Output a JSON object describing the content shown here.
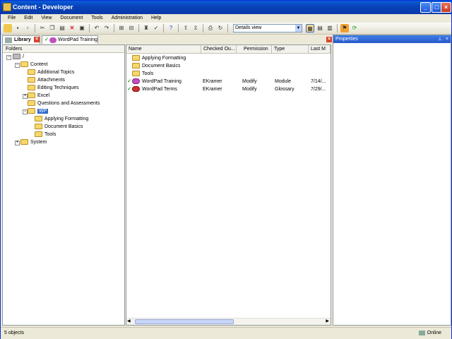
{
  "window": {
    "title": "Content - Developer",
    "min": "_",
    "max": "□",
    "close": "×"
  },
  "menu": [
    "File",
    "Edit",
    "View",
    "Document",
    "Tools",
    "Administration",
    "Help"
  ],
  "toolbar": {
    "view_select": "Details view"
  },
  "tabs": {
    "library": "Library",
    "doc": "WordPad Training"
  },
  "folders": {
    "header": "Folders",
    "root": "/",
    "content": "Content",
    "additional": "Additional Topics",
    "attachments": "Attachments",
    "editing": "Editing Techniques",
    "excel": "Excel",
    "questions": "Questions and Assessments",
    "wp": "WP",
    "applying": "Applying Formatting",
    "docbasics": "Document Basics",
    "tools": "Tools",
    "system": "System"
  },
  "columns": [
    "Name",
    "Checked Ou...",
    "Permission",
    "Type",
    "Last M"
  ],
  "rows": [
    {
      "name": "Applying Formatting",
      "checked": "",
      "perm": "",
      "type": "",
      "last": ""
    },
    {
      "name": "Document Basics",
      "checked": "",
      "perm": "",
      "type": "",
      "last": ""
    },
    {
      "name": "Tools",
      "checked": "",
      "perm": "",
      "type": "",
      "last": ""
    },
    {
      "name": "WordPad Training",
      "checked": "EKramer",
      "perm": "Modify",
      "type": "Module",
      "last": "7/14/..."
    },
    {
      "name": "WordPad Terms",
      "checked": "EKramer",
      "perm": "Modify",
      "type": "Glossary",
      "last": "7/29/..."
    }
  ],
  "properties": {
    "title": "Properties"
  },
  "status": {
    "count": "5 objects",
    "online": "Online"
  }
}
